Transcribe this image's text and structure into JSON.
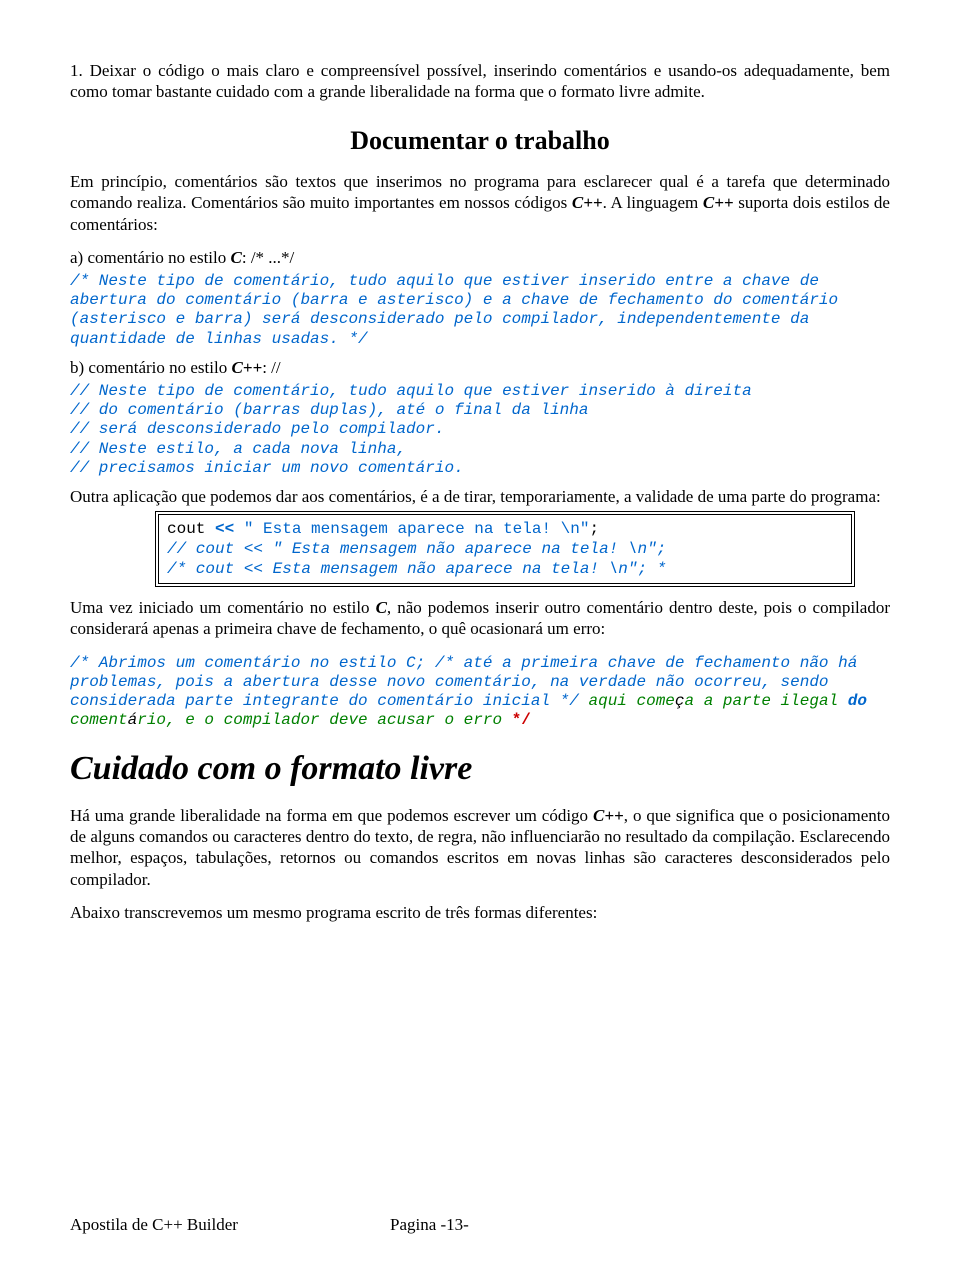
{
  "intro": {
    "p1": "1. Deixar o código o mais claro e compreensível possível, inserindo comentários e usando-os adequadamente, bem como tomar bastante cuidado com a grande liberalidade na forma que o formato livre admite."
  },
  "section_title": "Documentar o trabalho",
  "doc": {
    "p1a": "Em princípio, comentários são textos que inserimos no programa para esclarecer qual é a tarefa que determinado comando realiza. Comentários são muito importantes em nossos códigos ",
    "cpp": "C++",
    "p1b": ". A linguagem ",
    "p1c": " suporta dois estilos de comentários:"
  },
  "section_a": {
    "label_a": "a) comentário no estilo ",
    "c_label": "C",
    "suffix": ": /* ...*/",
    "comment": "/* Neste tipo de comentário, tudo aquilo que estiver inserido entre a chave de abertura do comentário (barra e asterisco) e a chave de fechamento do comentário (asterisco e barra) será desconsiderado pelo compilador, independentemente da quantidade de linhas usadas. */"
  },
  "section_b": {
    "label_b": "b) comentário no estilo ",
    "cpp_label": "C++",
    "suffix": ": //",
    "line1": "// Neste tipo de comentário, tudo aquilo que estiver inserido à direita",
    "line2": "// do comentário (barras duplas), até o final da linha",
    "line3": "// será desconsiderado pelo compilador.",
    "line4": "// Neste estilo, a cada nova linha,",
    "line5": "// precisamos iniciar um novo comentário."
  },
  "other_use": {
    "p": "Outra aplicação que podemos dar aos comentários, é a de tirar, temporariamente, a validade de uma parte do programa:"
  },
  "codebox": {
    "l1_cout": "cout ",
    "l1_op": "<< ",
    "l1_str": "\" Esta mensagem aparece na tela! \\n\"",
    "l1_semi": ";",
    "l2": "// cout << \" Esta mensagem não aparece na tela! \\n\";",
    "l3": "/* cout << Esta mensagem não aparece na tela! \\n\"; *"
  },
  "after_box": {
    "p_a": "Uma vez iniciado um comentário no estilo ",
    "c_label": "C",
    "p_b": ", não podemos inserir outro comentário dentro deste, pois o compilador considerará apenas a primeira chave de fechamento, o quê ocasionará um erro:"
  },
  "nested": {
    "part1": "/* Abrimos um comentário no estilo C; /* até a primeira chave de fechamento não há problemas, pois a abertura desse novo comentário, na verdade não ocorreu, sendo considerada parte integrante do comentário inicial */",
    "aqui": " aqui come",
    "c_cedilla": "ç",
    "parte_ilegal_a": "a a parte ilegal ",
    "do_kw": "do",
    "coment": " coment",
    "a_acc": "á",
    "rio": "rio, e o compilador deve acusar o erro ",
    "end": "*/"
  },
  "big_title": "Cuidado com o formato livre",
  "cuidado": {
    "p1a": "Há uma grande liberalidade na forma em que podemos escrever um código ",
    "cpp": "C++",
    "p1b": ", o que significa que o posicionamento de alguns comandos ou caracteres dentro do texto, de regra, não influenciarão no resultado da compilação. Esclarecendo melhor, espaços, tabulações, retornos ou comandos escritos em novas linhas são caracteres desconsiderados pelo compilador.",
    "p2": "Abaixo transcrevemos um mesmo programa escrito de três formas diferentes:"
  },
  "footer": {
    "left": "Apostila de C++ Builder",
    "center": "Pagina   -13-"
  }
}
